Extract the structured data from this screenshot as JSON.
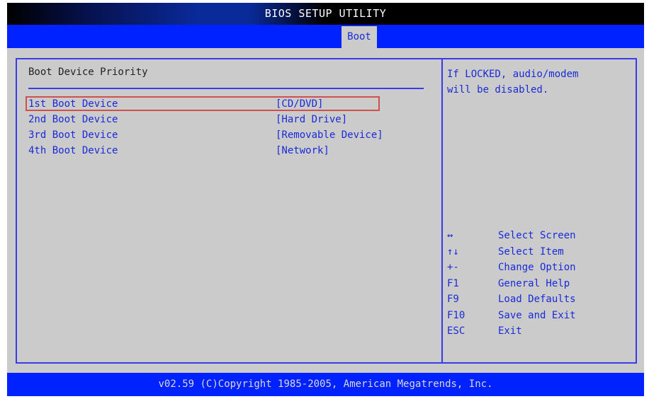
{
  "window": {
    "title": "BIOS SETUP UTILITY"
  },
  "tabs": [
    {
      "label": "Boot",
      "active": true
    }
  ],
  "main": {
    "section_title": "Boot Device Priority",
    "items": [
      {
        "label": "1st Boot Device",
        "value": "[CD/DVD]",
        "selected": true
      },
      {
        "label": "2nd Boot Device",
        "value": "[Hard Drive]",
        "selected": false
      },
      {
        "label": "3rd Boot Device",
        "value": "[Removable Device]",
        "selected": false
      },
      {
        "label": "4th Boot Device",
        "value": "[Network]",
        "selected": false
      }
    ]
  },
  "help": {
    "lines": [
      "If LOCKED, audio/modem",
      "will be disabled."
    ],
    "keys": [
      {
        "key": "↔",
        "desc": "Select Screen"
      },
      {
        "key": "↑↓",
        "desc": "Select Item"
      },
      {
        "key": "+-",
        "desc": "Change Option"
      },
      {
        "key": "F1",
        "desc": "General Help"
      },
      {
        "key": "F9",
        "desc": "Load Defaults"
      },
      {
        "key": "F10",
        "desc": "Save and Exit"
      },
      {
        "key": "ESC",
        "desc": "Exit"
      }
    ]
  },
  "footer": {
    "text": "v02.59 (C)Copyright 1985-2005, American Megatrends, Inc."
  },
  "colors": {
    "accent_blue": "#0022ff",
    "text_blue": "#1a2ad8",
    "selection_red": "#d05050",
    "panel_gray": "#cbcbcb"
  }
}
